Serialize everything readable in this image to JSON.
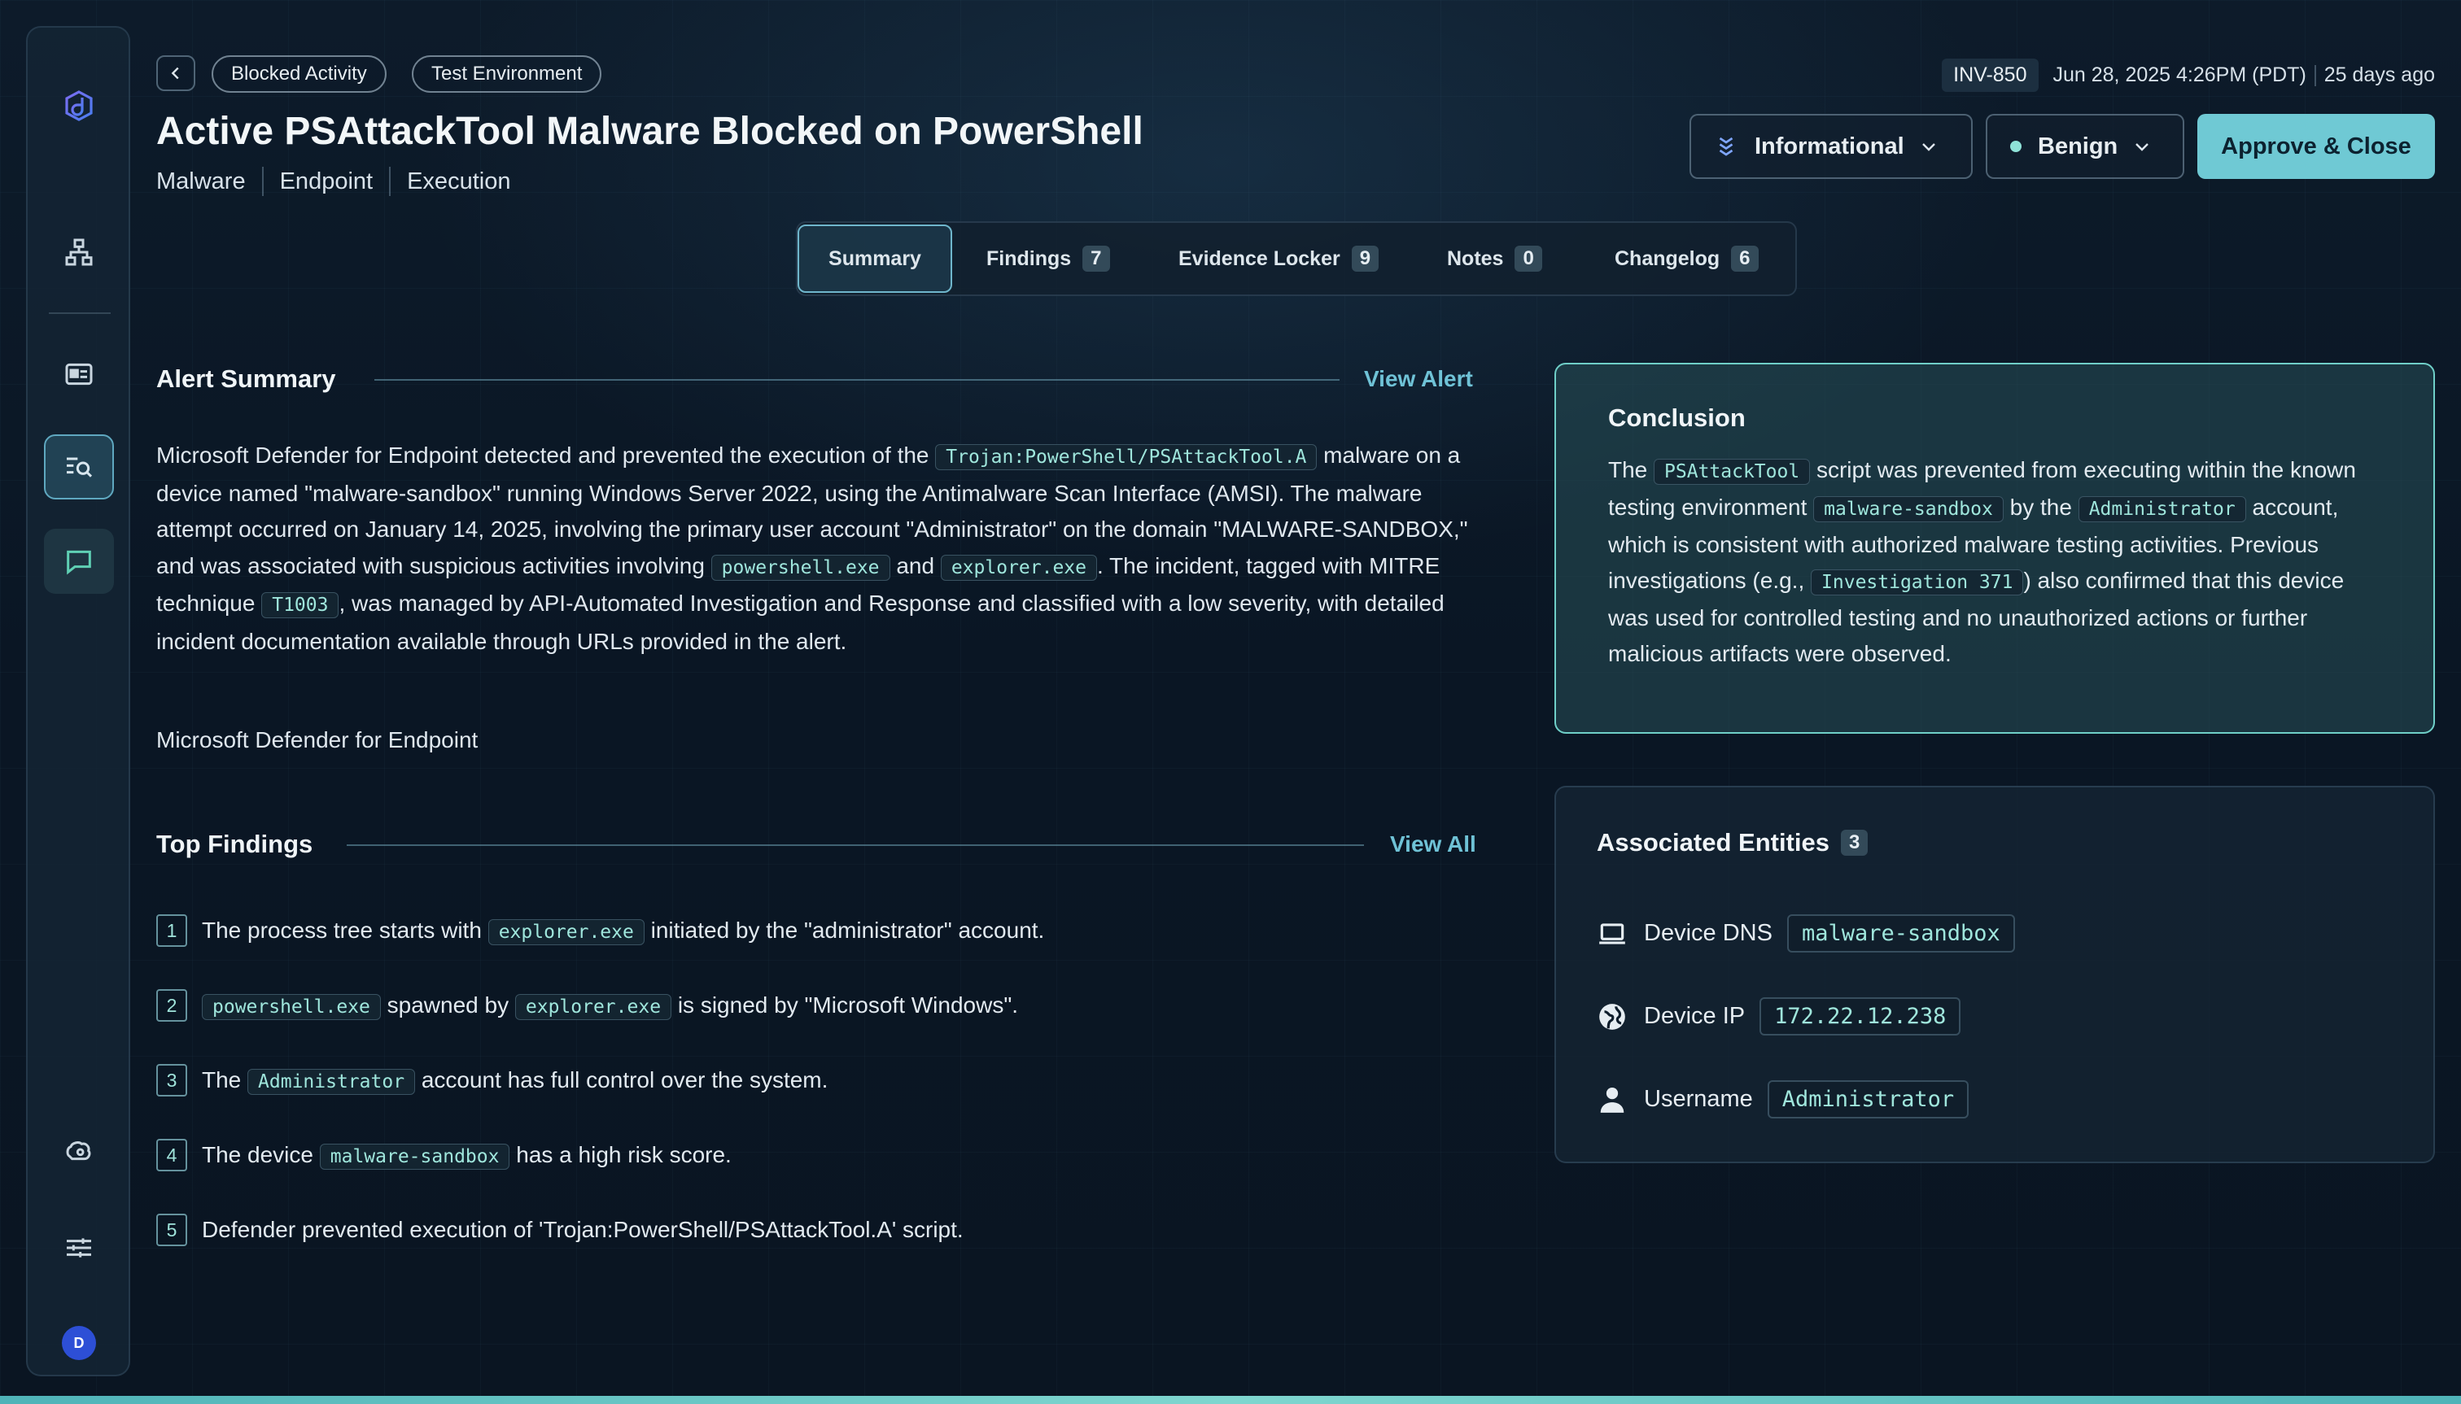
{
  "header": {
    "chips": [
      "Blocked Activity",
      "Test Environment"
    ],
    "title": "Active PSAttackTool Malware Blocked on PowerShell",
    "tags": [
      "Malware",
      "Endpoint",
      "Execution"
    ],
    "inv_id": "INV-850",
    "timestamp": "Jun 28, 2025 4:26PM (PDT)",
    "age": "25 days ago",
    "severity_label": "Informational",
    "verdict_label": "Benign",
    "approve_label": "Approve & Close"
  },
  "tabs": [
    {
      "label": "Summary",
      "count": ""
    },
    {
      "label": "Findings",
      "count": "7"
    },
    {
      "label": "Evidence Locker",
      "count": "9"
    },
    {
      "label": "Notes",
      "count": "0"
    },
    {
      "label": "Changelog",
      "count": "6"
    }
  ],
  "alert_summary": {
    "title": "Alert Summary",
    "link": "View Alert",
    "t1": "Microsoft Defender for Endpoint detected and prevented the execution of the ",
    "c1": "Trojan:PowerShell/PSAttackTool.A",
    "t2": " malware on a device named \"malware-sandbox\" running Windows Server 2022, using the Antimalware Scan Interface (AMSI). The malware attempt occurred on January 14, 2025, involving the primary user account \"Administrator\" on the domain \"MALWARE-SANDBOX,\" and was associated with suspicious activities involving ",
    "c2": "powershell.exe",
    "t3": " and ",
    "c3": "explorer.exe",
    "t4": ". The incident, tagged with MITRE technique ",
    "c4": "T1003",
    "t5": ", was managed by API-Automated Investigation and Response and classified with a low severity, with detailed incident documentation available through URLs provided in the alert.",
    "source": "Microsoft Defender for Endpoint"
  },
  "top_findings": {
    "title": "Top Findings",
    "link": "View All",
    "items": [
      {
        "num": "1",
        "a": "The process tree starts with ",
        "c1": "explorer.exe",
        "b": " initiated by the \"administrator\" account.",
        "c2": "",
        "c": ""
      },
      {
        "num": "2",
        "a": "",
        "c1": "powershell.exe",
        "b": " spawned by ",
        "c2": "explorer.exe",
        "c": " is signed by \"Microsoft Windows\"."
      },
      {
        "num": "3",
        "a": "The ",
        "c1": "Administrator",
        "b": " account has full control over the system.",
        "c2": "",
        "c": ""
      },
      {
        "num": "4",
        "a": "The device ",
        "c1": "malware-sandbox",
        "b": " has a high risk score.",
        "c2": "",
        "c": ""
      },
      {
        "num": "5",
        "a": "Defender prevented execution of 'Trojan:PowerShell/PSAttackTool.A' script.",
        "c1": "",
        "b": "",
        "c2": "",
        "c": ""
      }
    ]
  },
  "conclusion": {
    "title": "Conclusion",
    "t1": "The ",
    "c1": "PSAttackTool",
    "t2": " script was prevented from executing within the known testing environment ",
    "c2": "malware-sandbox",
    "t3": " by the ",
    "c3": "Administrator",
    "t4": " account, which is consistent with authorized malware testing activities. Previous investigations (e.g., ",
    "c4": "Investigation 371",
    "t5": ") also confirmed that this device was used for controlled testing and no unauthorized actions or further malicious artifacts were observed."
  },
  "entities": {
    "title": "Associated Entities",
    "count": "3",
    "rows": [
      {
        "icon": "laptop-icon",
        "label": "Device DNS",
        "value": "malware-sandbox"
      },
      {
        "icon": "globe-icon",
        "label": "Device IP",
        "value": "172.22.12.238"
      },
      {
        "icon": "user-icon",
        "label": "Username",
        "value": "Administrator"
      }
    ]
  },
  "sidebar": {
    "avatar_initial": "D"
  },
  "colors": {
    "accent": "#6fc9d4",
    "code_text": "#9fe6dc",
    "conclusion_border": "#6fcfc8",
    "avatar": "#2d4fd6"
  }
}
